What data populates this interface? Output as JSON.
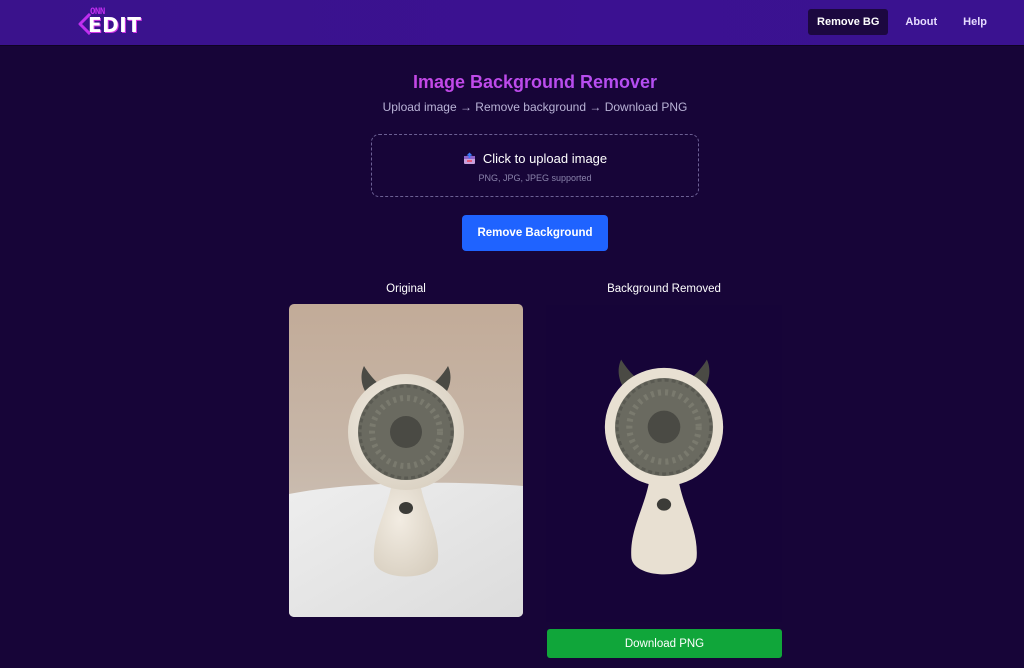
{
  "header": {
    "logo_small": "ONN",
    "logo_main": "EDIT",
    "nav": [
      {
        "label": "Remove BG",
        "active": true
      },
      {
        "label": "About",
        "active": false
      },
      {
        "label": "Help",
        "active": false
      }
    ]
  },
  "main": {
    "title": "Image Background Remover",
    "subtitle": "Upload image → Remove background → Download PNG",
    "upload": {
      "icon": "upload-box-icon",
      "label": "Click to upload image",
      "hint": "PNG, JPG, JPEG supported"
    },
    "remove_button": "Remove Background",
    "original_label": "Original",
    "removed_label": "Background Removed",
    "download_button": "Download PNG"
  },
  "colors": {
    "page_bg": "#170538",
    "header_bg": "#3a128c",
    "primary_button": "#1f63ff",
    "download_button": "#10a63a",
    "title_gradient_start": "#e03bd0",
    "title_gradient_end": "#9b5bff"
  }
}
